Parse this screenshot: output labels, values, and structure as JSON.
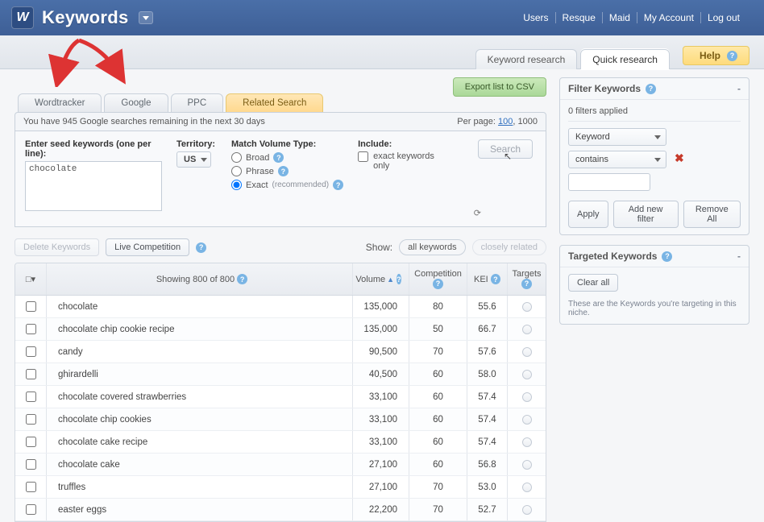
{
  "header": {
    "app_title": "Keywords",
    "logo_letter": "W",
    "links": [
      "Users",
      "Resque",
      "Maid",
      "My Account",
      "Log out"
    ]
  },
  "strip_tabs": {
    "research": "Keyword research",
    "quick": "Quick research",
    "help": "Help"
  },
  "export_label": "Export list to CSV",
  "source_tabs": {
    "wordtracker": "Wordtracker",
    "google": "Google",
    "ppc": "PPC",
    "related": "Related Search"
  },
  "meta": {
    "remaining": "You have 945 Google searches remaining in the next 30 days",
    "perpage_label": "Per page:",
    "perpage_100": "100",
    "perpage_1000": "1000"
  },
  "panel": {
    "seed_label": "Enter seed keywords (one per line):",
    "seed_value": "chocolate",
    "territory_label": "Territory:",
    "territory_value": "US",
    "match_label": "Match Volume Type:",
    "match_broad": "Broad",
    "match_phrase": "Phrase",
    "match_exact": "Exact",
    "match_recommended": "(recommended)",
    "include_label": "Include:",
    "include_exact_only": "exact keywords only",
    "search_label": "Search"
  },
  "actions": {
    "delete": "Delete Keywords",
    "live": "Live Competition",
    "show_label": "Show:",
    "all_keywords": "all keywords",
    "closely_related": "closely related"
  },
  "table": {
    "header_chk": "□▾",
    "header_showing": "Showing 800 of 800",
    "col_volume": "Volume",
    "col_competition": "Competition",
    "col_kei": "KEI",
    "col_targets": "Targets",
    "rows": [
      {
        "kw": "chocolate",
        "vol": "135,000",
        "comp": "80",
        "kei": "55.6"
      },
      {
        "kw": "chocolate chip cookie recipe",
        "vol": "135,000",
        "comp": "50",
        "kei": "66.7"
      },
      {
        "kw": "candy",
        "vol": "90,500",
        "comp": "70",
        "kei": "57.6"
      },
      {
        "kw": "ghirardelli",
        "vol": "40,500",
        "comp": "60",
        "kei": "58.0"
      },
      {
        "kw": "chocolate covered strawberries",
        "vol": "33,100",
        "comp": "60",
        "kei": "57.4"
      },
      {
        "kw": "chocolate chip cookies",
        "vol": "33,100",
        "comp": "60",
        "kei": "57.4"
      },
      {
        "kw": "chocolate cake recipe",
        "vol": "33,100",
        "comp": "60",
        "kei": "57.4"
      },
      {
        "kw": "chocolate cake",
        "vol": "27,100",
        "comp": "60",
        "kei": "56.8"
      },
      {
        "kw": "truffles",
        "vol": "27,100",
        "comp": "70",
        "kei": "53.0"
      },
      {
        "kw": "easter eggs",
        "vol": "22,200",
        "comp": "70",
        "kei": "52.7"
      }
    ]
  },
  "filter": {
    "title": "Filter Keywords",
    "applied": "0 filters applied",
    "field": "Keyword",
    "op": "contains",
    "apply": "Apply",
    "add": "Add new filter",
    "remove": "Remove All"
  },
  "targeted": {
    "title": "Targeted Keywords",
    "clear": "Clear all",
    "note": "These are the Keywords you're targeting in this niche."
  }
}
